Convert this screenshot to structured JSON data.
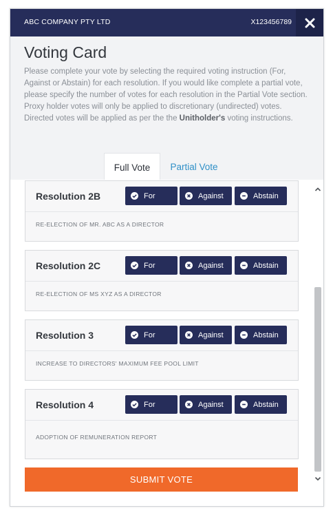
{
  "header": {
    "company": "ABC COMPANY PTY LTD",
    "holder_id": "X123456789"
  },
  "page": {
    "title": "Voting Card",
    "instructions_part1": "Please complete your vote by selecting the required voting instruction (For, Against or Abstain) for each resolution. If you would like complete a partial vote, please specify the number of votes for each resolution in the Partial Vote section. Proxy holder votes will only be applied to discretionary (undirected) votes. Directed votes will be applied as per the the ",
    "instructions_bold": "Unitholder's",
    "instructions_part2": " voting instructions."
  },
  "tabs": [
    {
      "label": "Full Vote",
      "active": true
    },
    {
      "label": "Partial Vote",
      "active": false
    }
  ],
  "vote_options": {
    "for": "For",
    "against": "Against",
    "abstain": "Abstain"
  },
  "resolutions": [
    {
      "title": "Resolution 2B",
      "description": "RE-ELECTION OF MR. ABC AS A DIRECTOR"
    },
    {
      "title": "Resolution 2C",
      "description": "RE-ELECTION OF MS XYZ AS A DIRECTOR"
    },
    {
      "title": "Resolution 3",
      "description": "INCREASE TO DIRECTORS' MAXIMUM FEE POOL LIMIT"
    },
    {
      "title": "Resolution 4",
      "description": "ADOPTION OF REMUNERATION REPORT"
    }
  ],
  "submit_label": "SUBMIT VOTE",
  "icons": {
    "close": "close-icon",
    "for": "check-circle-icon",
    "against": "x-circle-icon",
    "abstain": "minus-circle-icon",
    "scroll_up": "chevron-up-icon",
    "scroll_down": "chevron-down-icon"
  },
  "colors": {
    "header_bg": "#262d5a",
    "vote_button": "#262d5a",
    "submit": "#f0692a",
    "tab_link": "#2f8fc7"
  }
}
